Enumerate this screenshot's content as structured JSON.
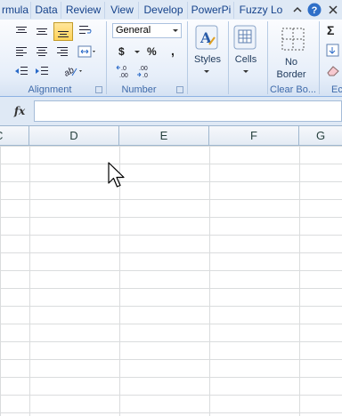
{
  "tabs": [
    "rmula",
    "Data",
    "Review",
    "View",
    "Develop",
    "PowerPi",
    "Fuzzy Lo"
  ],
  "ribbon": {
    "alignment_label": "Alignment",
    "number_label": "Number",
    "number_format": "General",
    "currency_symbol": "$",
    "percent_symbol": "%",
    "comma_symbol": ",",
    "increase_decimal": "←.0 .00",
    "decrease_decimal": ".00 →.0",
    "styles_label": "Styles",
    "cells_label": "Cells",
    "no_border_label_line1": "No",
    "no_border_label_line2": "Border",
    "clear_borders_label": "Clear Bo...",
    "partial_group_label": "Ec",
    "sigma": "Σ"
  },
  "formula_bar": {
    "fx_label": "fx",
    "content": ""
  },
  "columns": [
    "C",
    "D",
    "E",
    "F",
    "G"
  ],
  "colors": {
    "tab_bg": "#dfe9f5",
    "ribbon_accent": "#ffd35a",
    "header_text": "#15428b"
  }
}
